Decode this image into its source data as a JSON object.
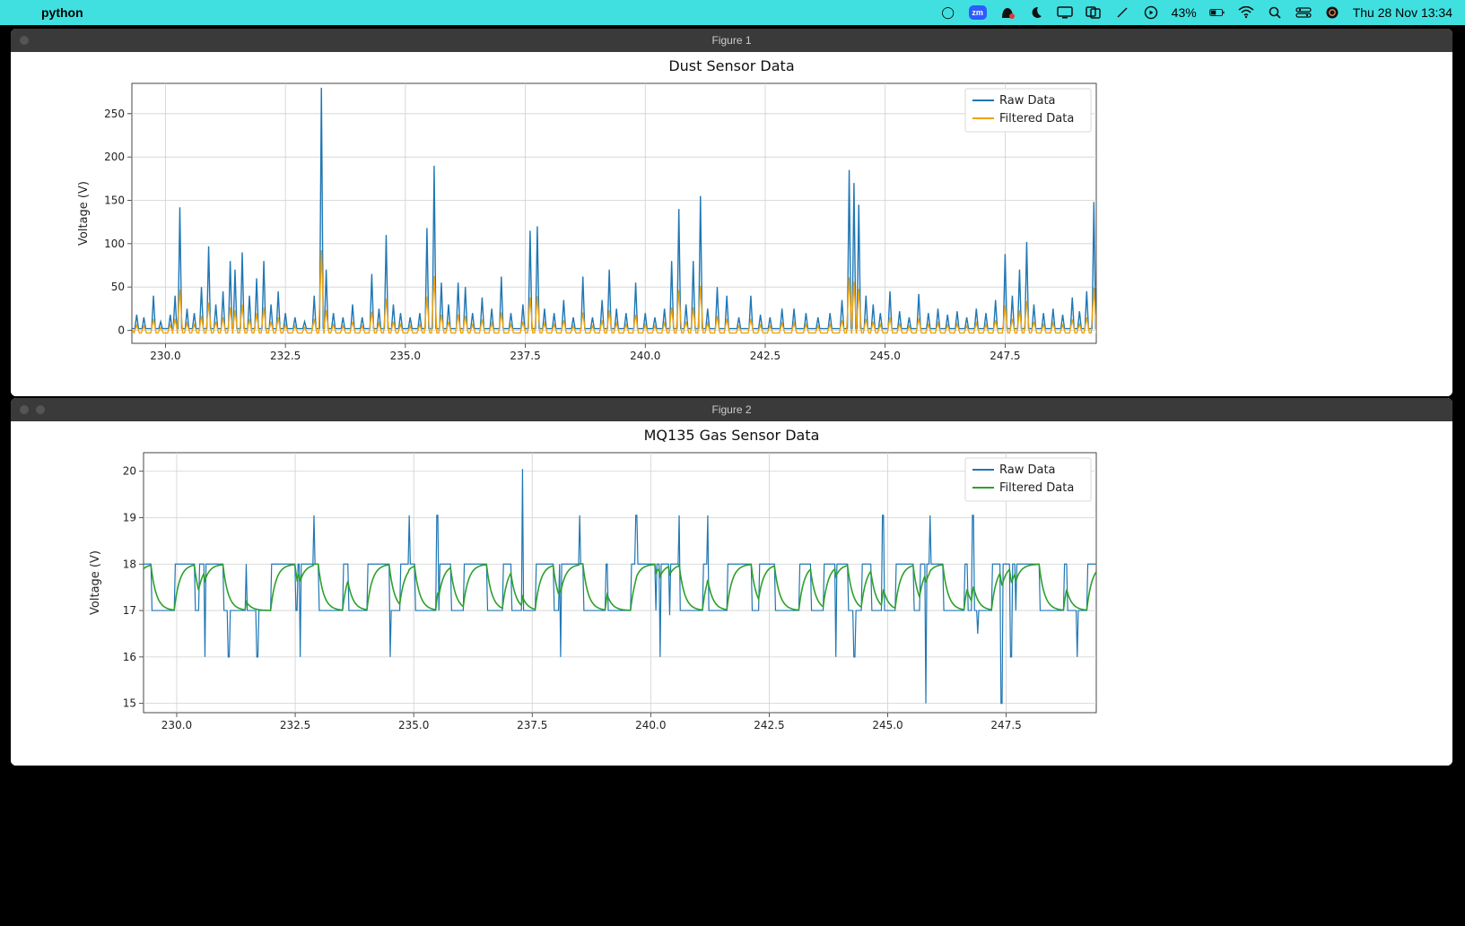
{
  "menubar": {
    "app": "python",
    "battery": "43%",
    "clock": "Thu 28 Nov  13:34"
  },
  "windows": {
    "fig1": {
      "title": "Figure 1"
    },
    "fig2": {
      "title": "Figure 2"
    }
  },
  "colors": {
    "raw": "#1f77b4",
    "filtered1": "#f0a30a",
    "filtered2": "#2ca02c"
  },
  "chart_data": [
    {
      "type": "line",
      "title": "Dust Sensor Data",
      "xlabel": "",
      "ylabel": "Voltage (V)",
      "xlim": [
        229.3,
        249.4
      ],
      "ylim": [
        -15,
        285
      ],
      "xticks": [
        230.0,
        232.5,
        235.0,
        237.5,
        240.0,
        242.5,
        245.0,
        247.5
      ],
      "yticks": [
        0,
        50,
        100,
        150,
        200,
        250
      ],
      "legend": [
        "Raw Data",
        "Filtered Data"
      ],
      "series": [
        {
          "name": "Raw Data",
          "color": "#1f77b4",
          "spikes": [
            {
              "x": 229.4,
              "y": 18
            },
            {
              "x": 229.55,
              "y": 15
            },
            {
              "x": 229.75,
              "y": 40
            },
            {
              "x": 229.9,
              "y": 10
            },
            {
              "x": 230.1,
              "y": 18
            },
            {
              "x": 230.2,
              "y": 40
            },
            {
              "x": 230.3,
              "y": 142
            },
            {
              "x": 230.45,
              "y": 25
            },
            {
              "x": 230.6,
              "y": 20
            },
            {
              "x": 230.75,
              "y": 50
            },
            {
              "x": 230.9,
              "y": 97
            },
            {
              "x": 231.05,
              "y": 30
            },
            {
              "x": 231.2,
              "y": 45
            },
            {
              "x": 231.35,
              "y": 80
            },
            {
              "x": 231.45,
              "y": 70
            },
            {
              "x": 231.6,
              "y": 90
            },
            {
              "x": 231.75,
              "y": 40
            },
            {
              "x": 231.9,
              "y": 60
            },
            {
              "x": 232.05,
              "y": 80
            },
            {
              "x": 232.2,
              "y": 30
            },
            {
              "x": 232.35,
              "y": 45
            },
            {
              "x": 232.5,
              "y": 20
            },
            {
              "x": 232.7,
              "y": 15
            },
            {
              "x": 232.9,
              "y": 10
            },
            {
              "x": 233.1,
              "y": 40
            },
            {
              "x": 233.25,
              "y": 280
            },
            {
              "x": 233.35,
              "y": 70
            },
            {
              "x": 233.5,
              "y": 20
            },
            {
              "x": 233.7,
              "y": 15
            },
            {
              "x": 233.9,
              "y": 30
            },
            {
              "x": 234.1,
              "y": 15
            },
            {
              "x": 234.3,
              "y": 65
            },
            {
              "x": 234.45,
              "y": 25
            },
            {
              "x": 234.6,
              "y": 110
            },
            {
              "x": 234.75,
              "y": 30
            },
            {
              "x": 234.9,
              "y": 20
            },
            {
              "x": 235.1,
              "y": 15
            },
            {
              "x": 235.3,
              "y": 20
            },
            {
              "x": 235.45,
              "y": 118
            },
            {
              "x": 235.6,
              "y": 190
            },
            {
              "x": 235.75,
              "y": 55
            },
            {
              "x": 235.9,
              "y": 30
            },
            {
              "x": 236.1,
              "y": 55
            },
            {
              "x": 236.25,
              "y": 50
            },
            {
              "x": 236.4,
              "y": 20
            },
            {
              "x": 236.6,
              "y": 38
            },
            {
              "x": 236.8,
              "y": 25
            },
            {
              "x": 237.0,
              "y": 62
            },
            {
              "x": 237.2,
              "y": 20
            },
            {
              "x": 237.45,
              "y": 30
            },
            {
              "x": 237.6,
              "y": 115
            },
            {
              "x": 237.75,
              "y": 120
            },
            {
              "x": 237.9,
              "y": 25
            },
            {
              "x": 238.1,
              "y": 20
            },
            {
              "x": 238.3,
              "y": 35
            },
            {
              "x": 238.5,
              "y": 15
            },
            {
              "x": 238.7,
              "y": 62
            },
            {
              "x": 238.9,
              "y": 15
            },
            {
              "x": 239.1,
              "y": 35
            },
            {
              "x": 239.25,
              "y": 70
            },
            {
              "x": 239.4,
              "y": 25
            },
            {
              "x": 239.6,
              "y": 20
            },
            {
              "x": 239.8,
              "y": 55
            },
            {
              "x": 240.0,
              "y": 20
            },
            {
              "x": 240.2,
              "y": 15
            },
            {
              "x": 240.4,
              "y": 25
            },
            {
              "x": 240.55,
              "y": 80
            },
            {
              "x": 240.7,
              "y": 140
            },
            {
              "x": 240.85,
              "y": 30
            },
            {
              "x": 241.0,
              "y": 80
            },
            {
              "x": 241.15,
              "y": 155
            },
            {
              "x": 241.3,
              "y": 25
            },
            {
              "x": 241.5,
              "y": 50
            },
            {
              "x": 241.7,
              "y": 40
            },
            {
              "x": 241.95,
              "y": 15
            },
            {
              "x": 242.2,
              "y": 40
            },
            {
              "x": 242.4,
              "y": 18
            },
            {
              "x": 242.6,
              "y": 15
            },
            {
              "x": 242.85,
              "y": 25
            },
            {
              "x": 243.1,
              "y": 25
            },
            {
              "x": 243.35,
              "y": 20
            },
            {
              "x": 243.6,
              "y": 15
            },
            {
              "x": 243.85,
              "y": 20
            },
            {
              "x": 244.1,
              "y": 35
            },
            {
              "x": 244.25,
              "y": 185
            },
            {
              "x": 244.35,
              "y": 170
            },
            {
              "x": 244.45,
              "y": 145
            },
            {
              "x": 244.6,
              "y": 40
            },
            {
              "x": 244.75,
              "y": 30
            },
            {
              "x": 244.9,
              "y": 20
            },
            {
              "x": 245.1,
              "y": 45
            },
            {
              "x": 245.3,
              "y": 22
            },
            {
              "x": 245.5,
              "y": 15
            },
            {
              "x": 245.7,
              "y": 42
            },
            {
              "x": 245.9,
              "y": 20
            },
            {
              "x": 246.1,
              "y": 25
            },
            {
              "x": 246.3,
              "y": 18
            },
            {
              "x": 246.5,
              "y": 22
            },
            {
              "x": 246.7,
              "y": 15
            },
            {
              "x": 246.9,
              "y": 25
            },
            {
              "x": 247.1,
              "y": 20
            },
            {
              "x": 247.3,
              "y": 35
            },
            {
              "x": 247.5,
              "y": 88
            },
            {
              "x": 247.65,
              "y": 40
            },
            {
              "x": 247.8,
              "y": 70
            },
            {
              "x": 247.95,
              "y": 102
            },
            {
              "x": 248.1,
              "y": 30
            },
            {
              "x": 248.3,
              "y": 20
            },
            {
              "x": 248.5,
              "y": 25
            },
            {
              "x": 248.7,
              "y": 18
            },
            {
              "x": 248.9,
              "y": 38
            },
            {
              "x": 249.05,
              "y": 22
            },
            {
              "x": 249.2,
              "y": 45
            },
            {
              "x": 249.35,
              "y": 148
            }
          ]
        },
        {
          "name": "Filtered Data",
          "color": "#f0a30a",
          "scale": 0.33
        }
      ]
    },
    {
      "type": "line",
      "title": "MQ135 Gas Sensor Data",
      "xlabel": "",
      "ylabel": "Voltage (V)",
      "xlim": [
        229.3,
        249.4
      ],
      "ylim": [
        14.8,
        20.4
      ],
      "xticks": [
        230.0,
        232.5,
        235.0,
        237.5,
        240.0,
        242.5,
        245.0,
        247.5
      ],
      "yticks": [
        15,
        16,
        17,
        18,
        19,
        20
      ],
      "legend": [
        "Raw Data",
        "Filtered Data"
      ],
      "series": [
        {
          "name": "Raw Data",
          "color": "#1f77b4",
          "note": "dense integer-valued signal oscillating 17↔18 with occasional spikes to 15,16,19,20",
          "base_low": 17,
          "base_high": 18,
          "spikes_high": [
            {
              "x": 232.9,
              "y": 19.05
            },
            {
              "x": 234.9,
              "y": 19.05
            },
            {
              "x": 235.5,
              "y": 19.05
            },
            {
              "x": 237.3,
              "y": 20.05
            },
            {
              "x": 238.5,
              "y": 19.05
            },
            {
              "x": 239.7,
              "y": 19.05
            },
            {
              "x": 240.6,
              "y": 19.05
            },
            {
              "x": 241.2,
              "y": 19.05
            },
            {
              "x": 244.9,
              "y": 19.05
            },
            {
              "x": 245.9,
              "y": 19.05
            },
            {
              "x": 246.8,
              "y": 19.05
            }
          ],
          "spikes_low": [
            {
              "x": 230.6,
              "y": 16.0
            },
            {
              "x": 231.1,
              "y": 16.0
            },
            {
              "x": 231.7,
              "y": 16.0
            },
            {
              "x": 232.6,
              "y": 16.0
            },
            {
              "x": 234.5,
              "y": 16.0
            },
            {
              "x": 238.1,
              "y": 16.0
            },
            {
              "x": 240.2,
              "y": 16.0
            },
            {
              "x": 240.4,
              "y": 16.9
            },
            {
              "x": 243.9,
              "y": 16.0
            },
            {
              "x": 244.3,
              "y": 16.0
            },
            {
              "x": 245.8,
              "y": 15.0
            },
            {
              "x": 246.9,
              "y": 16.5
            },
            {
              "x": 247.4,
              "y": 15.0
            },
            {
              "x": 247.6,
              "y": 16.0
            },
            {
              "x": 249.0,
              "y": 16.0
            }
          ]
        },
        {
          "name": "Filtered Data",
          "color": "#2ca02c",
          "note": "smoothed version near 17.0–18.2"
        }
      ]
    }
  ]
}
